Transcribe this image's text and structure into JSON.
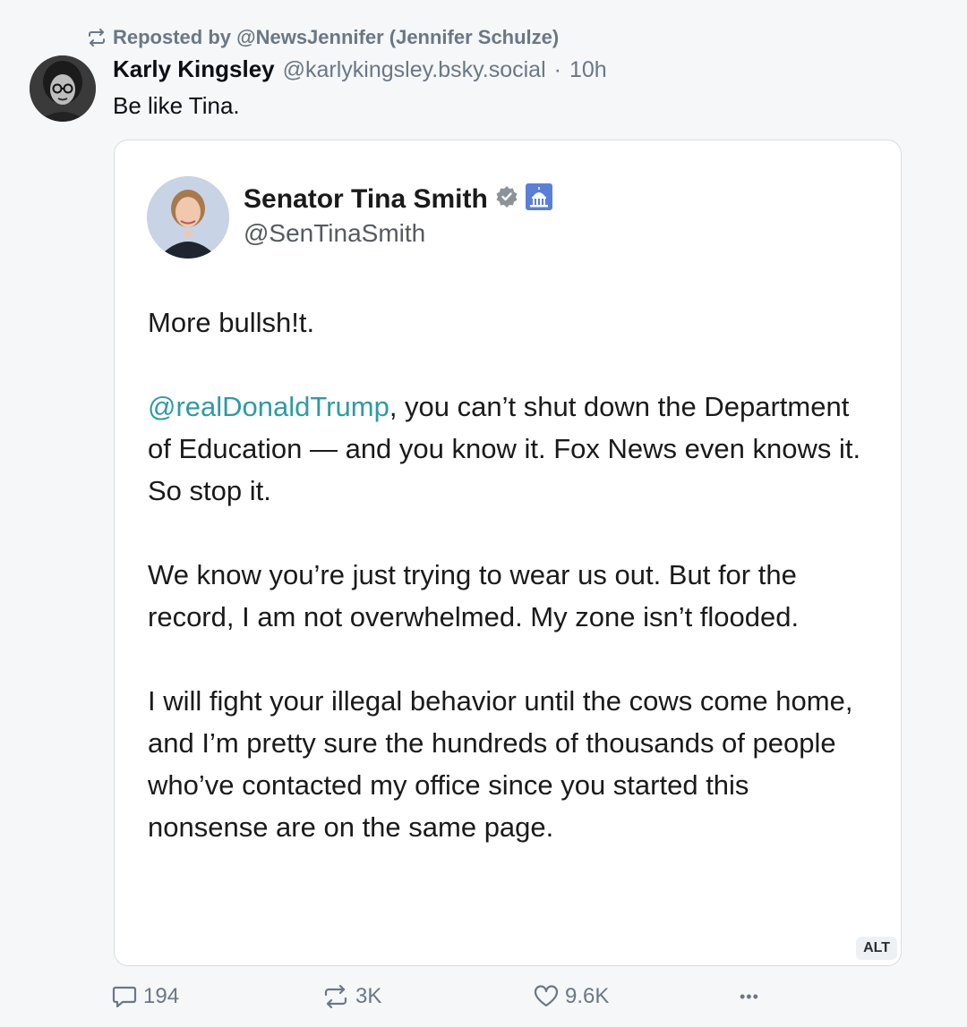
{
  "repost": {
    "label": "Reposted by @NewsJennifer (Jennifer Schulze)",
    "icon": "repost-icon"
  },
  "post": {
    "author_name": "Karly Kingsley",
    "author_handle": "@karlykingsley.bsky.social",
    "separator": "·",
    "time": "10h",
    "text": "Be like Tina."
  },
  "embed": {
    "name": "Senator Tina Smith",
    "handle": "@SenTinaSmith",
    "badges": [
      "verified-badge-icon",
      "capitol-icon"
    ],
    "paragraph1": "More bullsh!t.",
    "mention": "@realDonaldTrump",
    "paragraph2_rest": ", you can’t shut down the Department of Education — and you know it. Fox News even knows it. So stop it.",
    "paragraph3": "We know you’re just trying to wear us out. But for the record, I am not overwhelmed. My zone isn’t flooded.",
    "paragraph4": "I will fight your illegal behavior until the cows come home, and I’m pretty sure the hundreds of thousands of people who’ve contacted my office since you started this nonsense are on the same page.",
    "alt_label": "ALT",
    "mention_color": "#2e9aa6"
  },
  "actions": {
    "replies": "194",
    "reposts": "3K",
    "likes": "9.6K",
    "more": "•••"
  }
}
